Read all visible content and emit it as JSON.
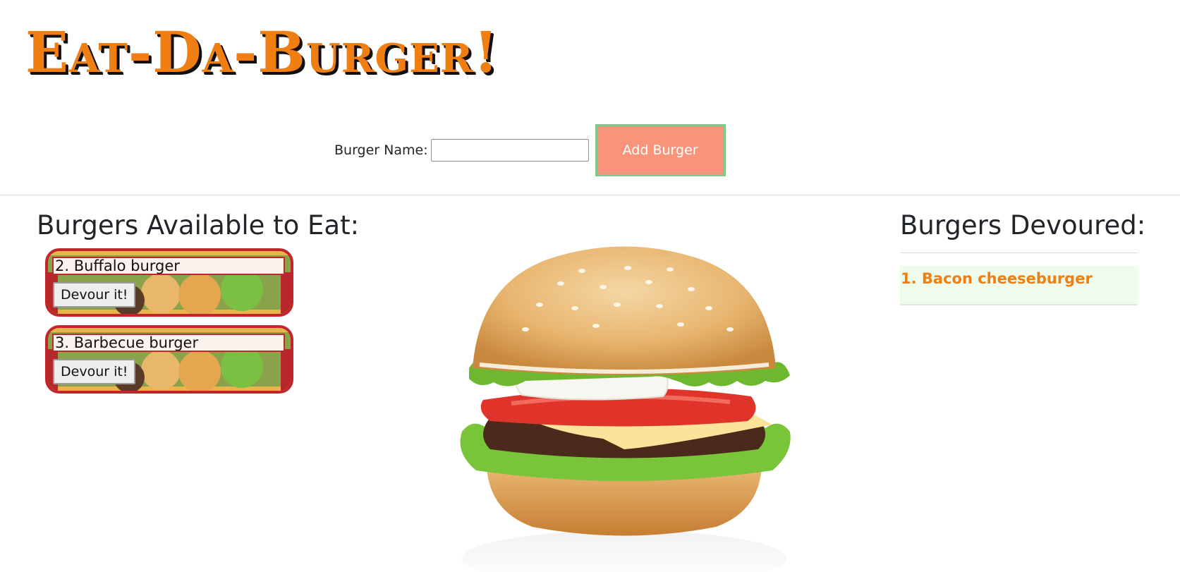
{
  "header": {
    "title": "Eat-Da-Burger!"
  },
  "form": {
    "label": "Burger Name:",
    "input_value": "",
    "input_placeholder": "",
    "submit_label": "Add Burger"
  },
  "available": {
    "title": "Burgers Available to Eat:",
    "items": [
      {
        "name": "2. Buffalo burger",
        "button_label": "Devour it!"
      },
      {
        "name": "3. Barbecue burger",
        "button_label": "Devour it!"
      }
    ]
  },
  "devoured": {
    "title": "Burgers Devoured:",
    "items": [
      {
        "name": "1. Bacon cheeseburger"
      }
    ]
  },
  "colors": {
    "title_orange": "#f07f13",
    "add_button_bg": "#f7947a",
    "add_button_border": "#7fc98d",
    "card_border": "#c0262b",
    "devoured_bg": "#effcec"
  }
}
